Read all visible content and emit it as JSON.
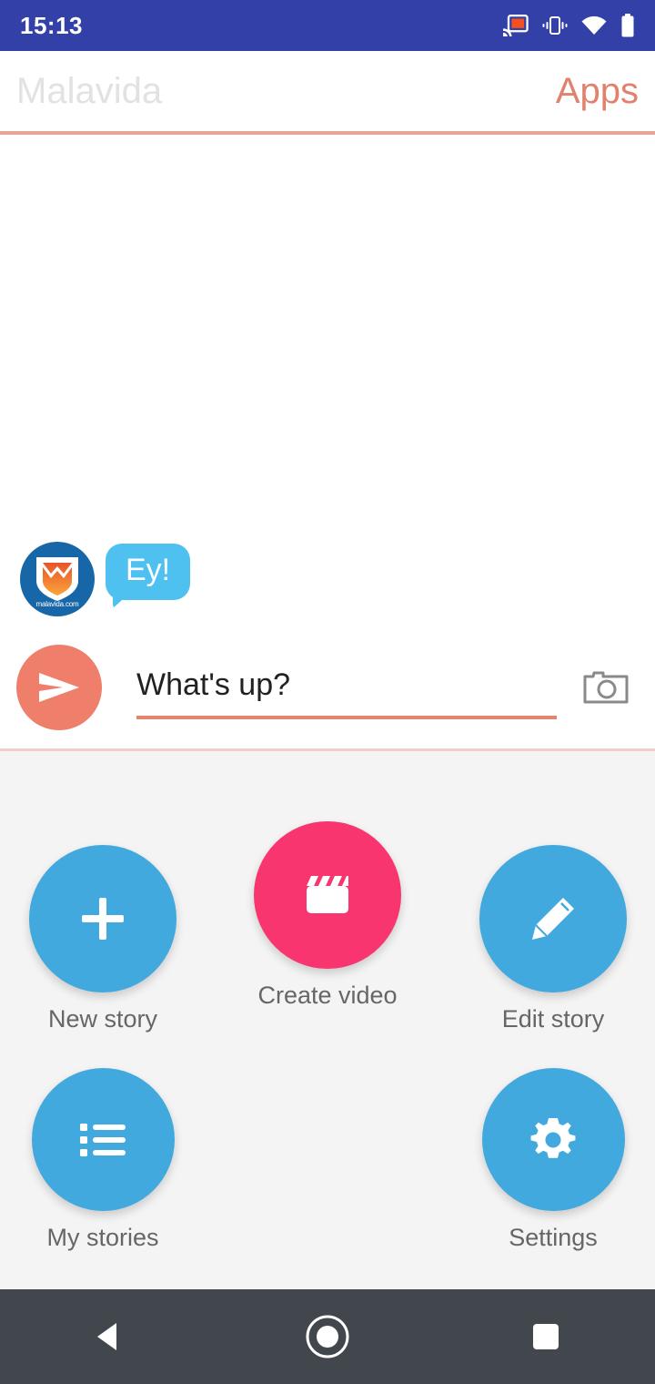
{
  "status_bar": {
    "time": "15:13",
    "icons": [
      "cast-icon",
      "vibrate-icon",
      "wifi-icon",
      "battery-icon"
    ],
    "background_color": "#3340a8"
  },
  "app_bar": {
    "title": "Malavida",
    "action_label": "Apps",
    "title_color": "#e2e2e2",
    "action_color": "#e0826e",
    "rule_color": "#e6a596"
  },
  "chat": {
    "avatar_name": "malavida-logo-avatar",
    "avatar_caption": "malavida.com",
    "avatar_background": "#1766a8",
    "messages": [
      {
        "text": "Ey!",
        "bubble_color": "#4fc1f0",
        "text_color": "#ffffff"
      }
    ]
  },
  "composer": {
    "send_button_label": "send-button",
    "send_button_color": "#ef7f6b",
    "input_value": "What's up?",
    "input_placeholder": "What's up?",
    "underline_color": "#e3846f",
    "camera_button_label": "camera-button"
  },
  "actions": {
    "background_color": "#f4f4f4",
    "items": [
      {
        "label": "New story",
        "icon": "plus-icon",
        "color": "#41a9dd"
      },
      {
        "label": "Create video",
        "icon": "clapperboard-icon",
        "color": "#f9356f"
      },
      {
        "label": "Edit story",
        "icon": "pencil-icon",
        "color": "#41a9dd"
      },
      {
        "label": "My stories",
        "icon": "list-icon",
        "color": "#41a9dd"
      },
      {
        "label": "Settings",
        "icon": "gear-icon",
        "color": "#41a9dd"
      }
    ]
  },
  "nav_bar": {
    "background_color": "#41474d",
    "buttons": [
      {
        "name": "back-button",
        "icon": "triangle-left-icon"
      },
      {
        "name": "home-button",
        "icon": "circle-icon"
      },
      {
        "name": "recents-button",
        "icon": "square-icon"
      }
    ]
  }
}
